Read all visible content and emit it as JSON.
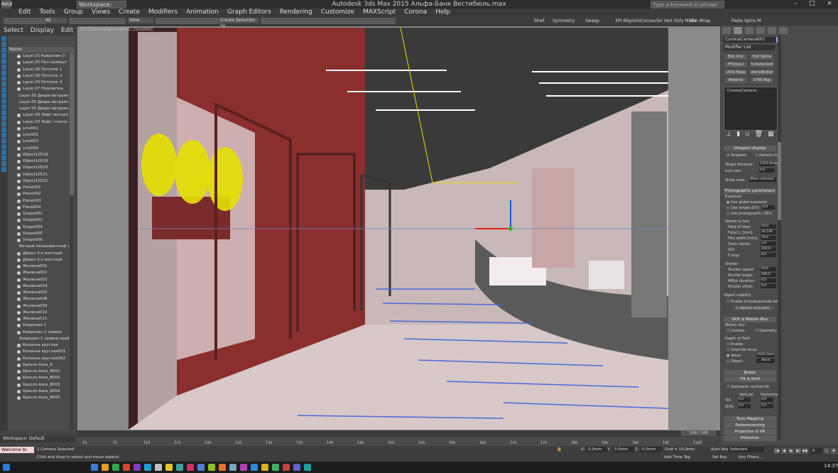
{
  "app": {
    "title": "Autodesk 3ds Max  2015    Альфа-Банк Вестибюль.max",
    "logo_text": "MAX",
    "workspace_label": "Workspace: Default",
    "search_placeholder": "Type a keyword or phrase"
  },
  "menu": [
    "Edit",
    "Tools",
    "Group",
    "Views",
    "Create",
    "Modifiers",
    "Animation",
    "Graph Editors",
    "Rendering",
    "Customize",
    "MAXScript",
    "Corona",
    "Help"
  ],
  "toolbar": {
    "selection_filter": "All",
    "view_mode": "View",
    "named_selection": "Create Selection Se",
    "labels": [
      "Shell",
      "Symmetry",
      "Sweep",
      "3PI Align",
      "UniConnector Vert Only Mode",
      "Skin Wrap",
      "Paste Splns M"
    ]
  },
  "scene_explorer": {
    "tabs": [
      "Select",
      "Display",
      "Edit"
    ],
    "column_header": "Name",
    "items": [
      "Layer:25 Ковролин 0",
      "Layer:25 Пол прямоуг",
      "Layer:26 Потолок 1",
      "Layer:26 Потолок 2",
      "Layer:26 Потолок 3",
      "Layer:27 Подсветка",
      "Layer:30 Двери витражн",
      "Layer:30 Двери витражн",
      "Layer:30 Двери витражн",
      "Layer:30 Лифт металл",
      "Layer:30 Лифт стекло",
      "Line001",
      "Line002",
      "Line003",
      "Line004",
      "Object10518",
      "Object10519",
      "Object10520",
      "Object10521",
      "Object10522",
      "Plane001",
      "Plane002",
      "Plane003",
      "Plane004",
      "Shape001",
      "Shape002",
      "Shape004",
      "Shape005",
      "Shape006",
      "Витраж безынерстный 2",
      "Диван 3-х местный",
      "Диван 3-х местный",
      "Жалюзи001",
      "Жалюзи002",
      "Жалюзи003",
      "Жалюзи004",
      "Жалюзи005",
      "Жалюзи008",
      "Жалюзи009",
      "Жалюзи010",
      "Жалюзи011",
      "Ковролин 1",
      "Ковролин 2 травка",
      "Ковролин 2 травка проф",
      "Колонна круглая",
      "Колонна круглая001",
      "Колонна круглая002",
      "Кресло Axos_8",
      "Кресло Axos_B001",
      "Кресло Axos_B002",
      "Кресло Axos_B003",
      "Кресло Axos_B004",
      "Кресло Axos_B005"
    ]
  },
  "viewport": {
    "label": "[+] [CoronaCamera001] [Shaded]",
    "time_slider": "100 / 100"
  },
  "command_panel": {
    "object_name": "CoronaCamera001",
    "object_color": "#8ea8ff",
    "modifier_list": "Modifier List",
    "modifier_buttons": [
      "Edit Poly",
      "Edit Spline",
      "FFD(box)",
      "TurboSmooth",
      "UVW Mapp",
      "aterialByEleme",
      "Material",
      "UVW Map"
    ],
    "stack_item": "CoronaCamera",
    "rollouts": {
      "viewport_display": {
        "title": "Viewport display",
        "targeted": "Targeted",
        "horizon": "Horizon line",
        "target_distance_label": "Target distance:",
        "target_distance": "2363,4mm",
        "icon_size_label": "Icon size:",
        "icon_size": "0,0",
        "show_cone_label": "Show cone:",
        "show_cone": "When selected"
      },
      "photographic": {
        "title": "Photographic parameters",
        "exposure": "Exposure",
        "use_global": "Use global exposure",
        "use_simple": "Use simple (EV):",
        "simple_val": "0,0",
        "use_photo": "Use photographic (ISO)",
        "sensor": "Sensor & lens",
        "fov_label": "Field of View:",
        "fov": "50,0",
        "focal_label": "Focal L. [mm]:",
        "focal": "34,539",
        "film_label": "Film width [mm]:",
        "film": "36,0",
        "zoom_label": "Zoom factor:",
        "zoom": "1,0",
        "iso_label": "ISO:",
        "iso": "100,0",
        "fstop_label": "F-stop:",
        "fstop": "8,0",
        "shutter": "Shutter",
        "shutter_speed_label": "Shutter speed:",
        "shutter_speed": "50,0",
        "shutter_angle_label": "Shutter angle:",
        "shutter_angle": "180,0",
        "mblur_label": "MBlur duration:",
        "mblur": "0,5",
        "shutter_offset_label": "Shutter offset:",
        "shutter_offset": "0,0"
      },
      "visibility": {
        "title": "Object visibility",
        "enable": "Enable include/exclude list",
        "excluded": "0 objects excluded..."
      },
      "dof": {
        "title": "DOF & Motion Blur",
        "motion_blur": "Motion blur:",
        "camera": "Camera",
        "geometry": "Geometry",
        "dof_label": "Depth of Field",
        "enable": "Enable",
        "override": "Override focus",
        "value": "Value:",
        "value_val": "1000,0mm",
        "object": "Object:",
        "object_val": "None"
      },
      "bokeh": "Bokeh",
      "tilt": {
        "title": "Tilt & Shift",
        "auto": "Automatic vertical tilt",
        "vertical": "Vertical:",
        "horizontal": "Horizontal:",
        "tilt": "Tilt:",
        "shift": "Shift:",
        "zero": "0,0"
      },
      "tone_mapping": "Tone Mapping",
      "postprocessing": "Postprocessing",
      "projection": "Projection & VR",
      "distortion": "Distortion"
    }
  },
  "trackbar": {
    "ticks": [
      0,
      5,
      10,
      15,
      20,
      25,
      30,
      35,
      40,
      45,
      50,
      55,
      60,
      65,
      70,
      75,
      80,
      85,
      90,
      95,
      100
    ]
  },
  "status": {
    "workspace": "Workspace: Default",
    "maxscript": "Welcome to",
    "selected": "1 Camera Selected",
    "prompt": "Click and drag to select and move objects",
    "x_label": "X:",
    "x": "0,0mm",
    "y_label": "Y:",
    "y": "0,0mm",
    "z_label": "Z:",
    "z": "0,0mm",
    "grid": "Grid = 10,0mm",
    "add_time_tag": "Add Time Tag",
    "auto_key": "Auto Key",
    "auto_key_mode": "Selected",
    "set_key": "Set Key",
    "key_filters": "Key Filters...",
    "frame": "0"
  },
  "taskbar": {
    "clock": "14:37"
  }
}
